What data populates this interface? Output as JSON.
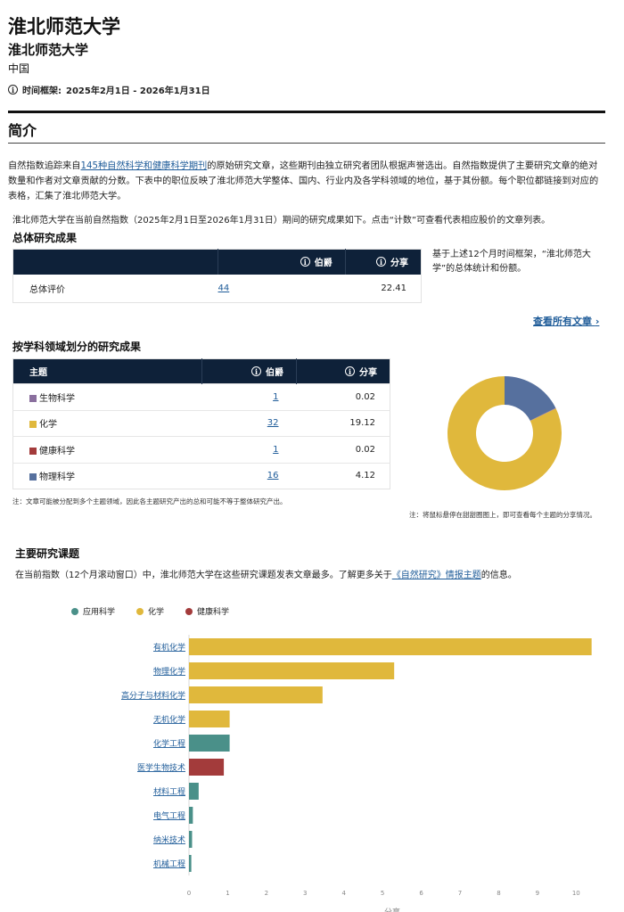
{
  "institution": {
    "name": "淮北师范大学",
    "subname": "淮北师范大学",
    "country": "中国"
  },
  "timeframe": {
    "icon": "info-icon",
    "label": "时间框架:",
    "value": "2025年2月1日 - 2026年1月31日"
  },
  "intro": {
    "heading": "简介",
    "para_pre": "自然指数追踪来自",
    "para_link": "145种自然科学和健康科学期刊",
    "para_post": "的原始研究文章，这些期刊由独立研究者团队根据声誉选出。自然指数提供了主要研究文章的绝对数量和作者对文章贡献的分数。下表中的职位反映了淮北师范大学整体、国内、行业内及各学科领域的地位，基于其份额。每个职位都链接到对应的表格，汇集了淮北师范大学。",
    "line2": "淮北师范大学在当前自然指数（2025年2月1日至2026年1月31日）期间的研究成果如下。点击“计数”可查看代表相应股价的文章列表。"
  },
  "overall": {
    "title": "总体研究成果",
    "col_count": "伯爵",
    "col_share": "分享",
    "row_label": "总体评价",
    "count": "44",
    "share": "22.41",
    "note": "基于上述12个月时间框架，“淮北师范大学”的总体统计和份额。",
    "view_all": "查看所有文章",
    "view_all_icon": "chevron-right-icon"
  },
  "subjects": {
    "title": "按学科领域划分的研究成果",
    "col_subject": "主题",
    "col_count": "伯爵",
    "col_share": "分享",
    "rows": [
      {
        "name": "生物科学",
        "count": "1",
        "share": "0.02",
        "color": "#8a6f9e"
      },
      {
        "name": "化学",
        "count": "32",
        "share": "19.12",
        "color": "#e0b83c"
      },
      {
        "name": "健康科学",
        "count": "1",
        "share": "0.02",
        "color": "#a33b3b"
      },
      {
        "name": "物理科学",
        "count": "16",
        "share": "4.12",
        "color": "#56709e"
      }
    ],
    "note": "注：文章可能被分配到多个主题领域，因此各主题研究产出的总和可能不等于整体研究产出。",
    "donut_note": "注：将鼠标悬停在甜甜圈图上，即可查看每个主题的分享情况。"
  },
  "topics": {
    "title": "主要研究课题",
    "desc_pre": "在当前指数（12个月滚动窗口）中，淮北师范大学在这些研究课题发表文章最多。了解更多关于",
    "desc_link": "《自然研究》情报主题",
    "desc_post": "的信息。"
  },
  "chart_data": {
    "type": "bar",
    "orientation": "horizontal",
    "xlabel": "分享",
    "xlim": [
      0,
      10.5
    ],
    "xticks": [
      0,
      1,
      2,
      3,
      4,
      5,
      6,
      7,
      8,
      9,
      10
    ],
    "legend": [
      {
        "name": "应用科学",
        "color": "#4a9089"
      },
      {
        "name": "化学",
        "color": "#e0b83c"
      },
      {
        "name": "健康科学",
        "color": "#a33b3b"
      }
    ],
    "categories": [
      "有机化学",
      "物理化学",
      "高分子与材料化学",
      "无机化学",
      "化学工程",
      "医学生物技术",
      "材料工程",
      "电气工程",
      "纳米技术",
      "机械工程"
    ],
    "values": [
      10.4,
      5.3,
      3.45,
      1.05,
      1.05,
      0.9,
      0.25,
      0.1,
      0.08,
      0.06
    ],
    "series_index": [
      1,
      1,
      1,
      1,
      0,
      2,
      0,
      0,
      0,
      0
    ]
  }
}
